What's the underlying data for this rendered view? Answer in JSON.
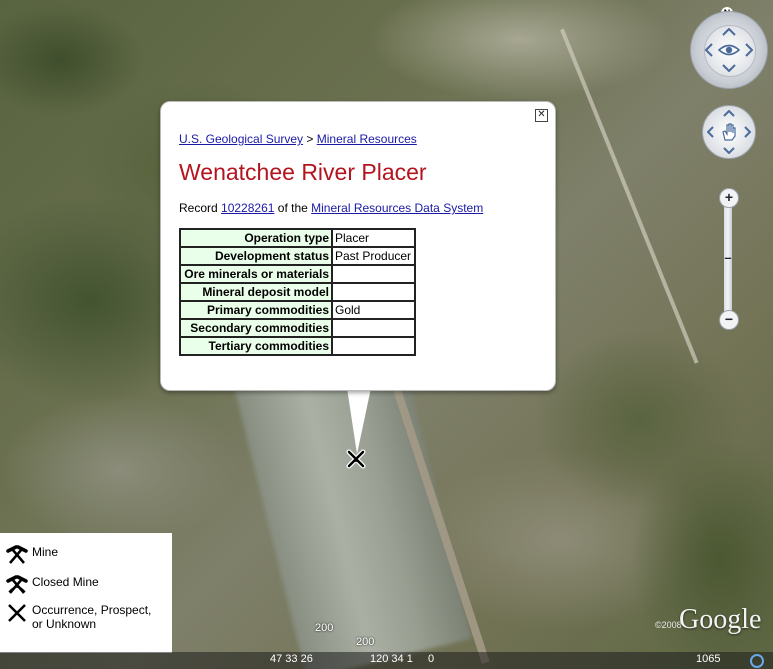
{
  "popup": {
    "breadcrumb": {
      "org": "U.S. Geological Survey",
      "separator": ">",
      "section": "Mineral Resources"
    },
    "title": "Wenatchee River Placer",
    "record_prefix": "Record",
    "record_id": "10228261",
    "record_middle": "of the",
    "record_system": "Mineral Resources Data System",
    "close_glyph": "✕",
    "table": [
      {
        "label": "Operation type",
        "value": "Placer"
      },
      {
        "label": "Development status",
        "value": "Past Producer"
      },
      {
        "label": "Ore minerals or materials",
        "value": ""
      },
      {
        "label": "Mineral deposit model",
        "value": ""
      },
      {
        "label": "Primary commodities",
        "value": "Gold"
      },
      {
        "label": "Secondary commodities",
        "value": ""
      },
      {
        "label": "Tertiary commodities",
        "value": ""
      }
    ]
  },
  "legend": {
    "items": [
      {
        "label": "Mine",
        "icon": "crossed-hammers-icon"
      },
      {
        "label": "Closed Mine",
        "icon": "closed-mine-icon"
      },
      {
        "label": "Occurrence, Prospect,",
        "label2": "or Unknown",
        "icon": "x-mark-icon"
      }
    ]
  },
  "nav": {
    "north": "N",
    "zoom_in": "+",
    "zoom_out": "−"
  },
  "attribution": {
    "logo": "Google",
    "year": "©2008"
  },
  "scale": {
    "top": "200",
    "bottom": "200"
  },
  "status": {
    "lat": "47 33 26",
    "lon": "120 34 1",
    "elev": "0",
    "alt": "1065"
  },
  "colors": {
    "title": "#b3141e",
    "link": "#1a1aa6",
    "table_key_bg": "#eaffea"
  }
}
